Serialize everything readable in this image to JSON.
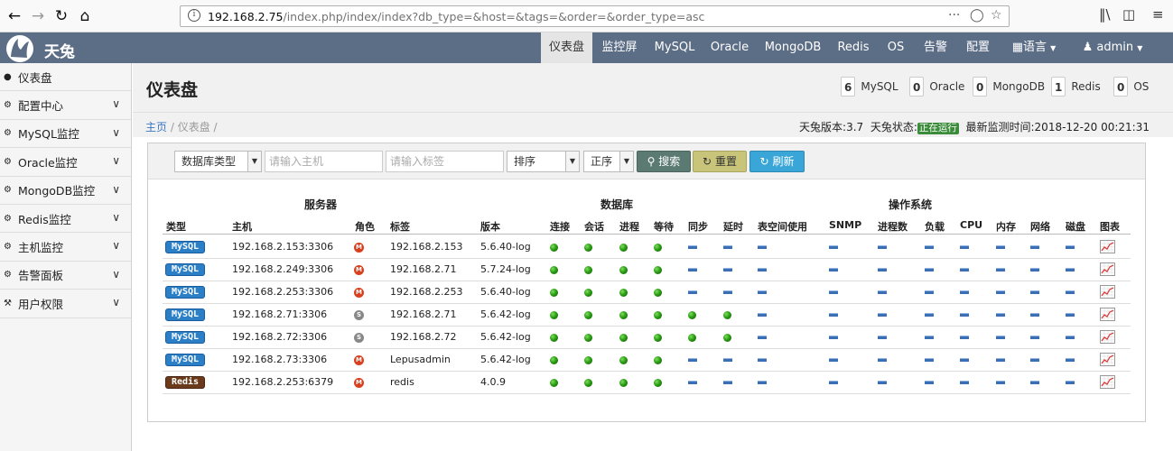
{
  "browser": {
    "url_host": "192.168.2.75",
    "url_path": "/index.php/index/index?db_type=&host=&tags=&order=&order_type=asc"
  },
  "app": {
    "brand": "天兔"
  },
  "nav": {
    "items": [
      "仪表盘",
      "监控屏",
      "MySQL",
      "Oracle",
      "MongoDB",
      "Redis",
      "OS",
      "告警",
      "配置"
    ],
    "language": "语言",
    "user": "admin"
  },
  "sidebar": {
    "items": [
      {
        "label": "仪表盘",
        "icon": "comment-icon",
        "chevron": false
      },
      {
        "label": "配置中心",
        "icon": "cog-icon",
        "chevron": true
      },
      {
        "label": "MySQL监控",
        "icon": "cog-icon",
        "chevron": true
      },
      {
        "label": "Oracle监控",
        "icon": "cog-icon",
        "chevron": true
      },
      {
        "label": "MongoDB监控",
        "icon": "cog-icon",
        "chevron": true
      },
      {
        "label": "Redis监控",
        "icon": "cog-icon",
        "chevron": true
      },
      {
        "label": "主机监控",
        "icon": "cog-icon",
        "chevron": true
      },
      {
        "label": "告警面板",
        "icon": "cog-icon",
        "chevron": true
      },
      {
        "label": "用户权限",
        "icon": "key-icon",
        "chevron": true
      }
    ]
  },
  "header": {
    "title": "仪表盘",
    "stats": [
      {
        "count": "6",
        "label": "MySQL"
      },
      {
        "count": "0",
        "label": "Oracle"
      },
      {
        "count": "0",
        "label": "MongoDB"
      },
      {
        "count": "1",
        "label": "Redis"
      },
      {
        "count": "0",
        "label": "OS"
      }
    ]
  },
  "breadcrumb": {
    "home": "主页",
    "current": "仪表盘"
  },
  "status": {
    "version_label": "天兔版本:3.7",
    "state_label": "天兔状态:",
    "state_badge": "正在运行",
    "time_label": "最新监测时间:2018-12-20 00:21:31"
  },
  "filters": {
    "db_type": "数据库类型",
    "host_placeholder": "请输入主机",
    "tags_placeholder": "请输入标签",
    "order": "排序",
    "order_type": "正序",
    "search": "搜索",
    "reset": "重置",
    "refresh": "刷新"
  },
  "table": {
    "groups": [
      "服务器",
      "数据库",
      "操作系统"
    ],
    "columns": [
      "类型",
      "主机",
      "角色",
      "标签",
      "版本",
      "连接",
      "会话",
      "进程",
      "等待",
      "同步",
      "延时",
      "表空间使用",
      "SNMP",
      "进程数",
      "负载",
      "CPU",
      "内存",
      "网络",
      "磁盘",
      "图表"
    ],
    "rows": [
      {
        "type": "MySQL",
        "host": "192.168.2.153:3306",
        "role": "M",
        "tag": "192.168.2.153",
        "version": "5.6.40-log",
        "sync": false
      },
      {
        "type": "MySQL",
        "host": "192.168.2.249:3306",
        "role": "M",
        "tag": "192.168.2.71",
        "version": "5.7.24-log",
        "sync": false
      },
      {
        "type": "MySQL",
        "host": "192.168.2.253:3306",
        "role": "M",
        "tag": "192.168.2.253",
        "version": "5.6.40-log",
        "sync": false
      },
      {
        "type": "MySQL",
        "host": "192.168.2.71:3306",
        "role": "S",
        "tag": "192.168.2.71",
        "version": "5.6.42-log",
        "sync": true
      },
      {
        "type": "MySQL",
        "host": "192.168.2.72:3306",
        "role": "S",
        "tag": "192.168.2.72",
        "version": "5.6.42-log",
        "sync": true
      },
      {
        "type": "MySQL",
        "host": "192.168.2.73:3306",
        "role": "M",
        "tag": "Lepusadmin",
        "version": "5.6.42-log",
        "sync": false
      },
      {
        "type": "Redis",
        "host": "192.168.2.253:6379",
        "role": "M",
        "tag": "redis",
        "version": "4.0.9",
        "sync": false
      }
    ]
  }
}
